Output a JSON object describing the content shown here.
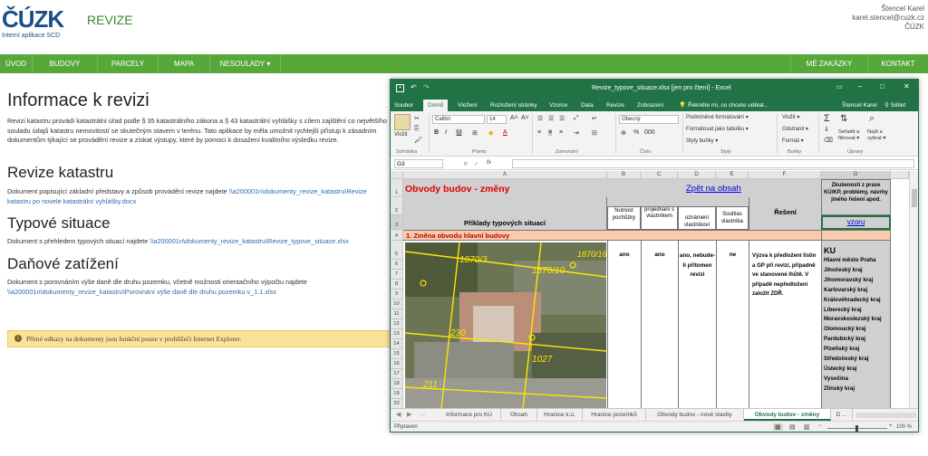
{
  "header": {
    "logo": "ČÚZK",
    "logo_sub": "Interní aplikace SCD",
    "app_title": "REVIZE",
    "user_name": "Štencel Karel",
    "user_email": "karel.stencel@cuzk.cz",
    "user_org": "ČÚZK"
  },
  "nav": {
    "items": [
      "ÚVOD",
      "BUDOVY",
      "PARCELY",
      "MAPA",
      "NESOULADY ▾"
    ],
    "right_items": [
      "MÉ ZAKÁZKY",
      "KONTAKT"
    ]
  },
  "content": {
    "title": "Informace k revizi",
    "intro": "Revizi katastru provádí katastrální úřad podle § 35 katastrálního zákona a § 43 katastrální vyhlášky s cílem zajištění co největšího souladu údajů katastru nemovitostí se skutečným stavem v terénu. Tato aplikace by měla umožnit rychlejší přístup k zásadním dokumentům týkající se provádění revize a získat výstupy, které by pomoci k dosažení kvalitního výsledku revize.",
    "s1_title": "Revize katastru",
    "s1_text": "Dokument popisující základní představy a způsob provádění revize najdete ",
    "s1_link": "\\\\a200001n\\dokumenty_revize_katastru\\Revize katastru po novele katastrální vyhlášky.docx",
    "s2_title": "Typové situace",
    "s2_text": "Dokument s přehledem typových situací najdete ",
    "s2_link": "\\\\a200001n\\dokumenty_revize_katastru\\Revize_typove_situace.xlsx",
    "s3_title": "Daňové zatížení",
    "s3_text": "Dokument s porovnáním výše daně dle druhu pozemku, včetně možnosti orientačního výpočtu najdete ",
    "s3_link": "\\\\a200001n\\dokumenty_revize_katastru\\Porovnání výše daně dle druhu pozemku v_1.1.xlsx",
    "notice": "Přímé odkazy na dokumenty jsou funkční pouze v prohlížeči Internet Explorer."
  },
  "excel": {
    "title": "Revize_typove_situace.xlsx  [jen pro čtení]  -  Excel",
    "user": "Štencel Karel",
    "share": "Sdílet",
    "ribbon_tabs": [
      "Soubor",
      "Domů",
      "Vložení",
      "Rozložení stránky",
      "Vzorce",
      "Data",
      "Revize",
      "Zobrazení"
    ],
    "tell_me": "Řekněte mi, co chcete udělat...",
    "font_name": "Calibri",
    "font_size": "14",
    "number_format": "Obecný",
    "groups": [
      "Schránka",
      "Písmo",
      "Zarovnání",
      "Číslo",
      "Styly",
      "Buňky",
      "Úpravy"
    ],
    "styles_items": [
      "Podmíněné formátování ▾",
      "Formátovat jako tabulku ▾",
      "Styly buňky ▾"
    ],
    "cells_items": [
      "Vložit ▾",
      "Odstranit ▾",
      "Formát ▾"
    ],
    "edit_items": [
      "Seřadit a filtrovat ▾",
      "Najít a vybrat ▾"
    ],
    "paste_label": "Vložit",
    "name_box": "G3",
    "fx": "fx",
    "columns": [
      "A",
      "B",
      "C",
      "D",
      "E",
      "F",
      "G"
    ],
    "rows": [
      "1",
      "2",
      "3",
      "4",
      "5",
      "6",
      "7",
      "8",
      "9",
      "10",
      "11",
      "12",
      "13",
      "14",
      "15",
      "16",
      "17",
      "18",
      "19",
      "20"
    ],
    "sheet_title": "Obvody budov - změny",
    "back_link": "Zpět na obsah",
    "col_headers": {
      "a": "Příklady typových situací",
      "b": "Nutnost pochůzky",
      "c": "projednání s vlastníkem",
      "d": "oznámení vlastníkovi",
      "e": "Souhlas vlastníka",
      "f": "Řešení",
      "g": "Zkušenosti z praxe KÚ/KP, problémy, návrhy jiného řešení apod."
    },
    "vzoru": "vzoru",
    "section_title": "1. Změna obvodu hlavní budovy",
    "row_values": {
      "b": "ano",
      "c": "ano",
      "d": "ano, nebude-li přítomen revizi",
      "e": "ne"
    },
    "solution": "Výzva k předložení listin a GP při revizi, případně ve stanovené lhůtě. V případě nepředložení založit ZDŘ.",
    "ku_title": "KU",
    "ku_list": [
      "Hlavní město Praha",
      "Jihočeský kraj",
      "Jihomoravský kraj",
      "Karlovarský kraj",
      "Královéhradecký kraj",
      "Liberecký kraj",
      "Moravskoslezský kraj",
      "Olomoucký kraj",
      "Pardubický kraj",
      "Plzeňský kraj",
      "Středočeský kraj",
      "Ústecký kraj",
      "Vysočina",
      "Zlínský kraj"
    ],
    "map_labels": [
      "1870/3",
      "1870/10",
      "1870/16",
      "230",
      "1027",
      "211"
    ],
    "sheet_tabs": [
      "Informace pro KÚ",
      "Obsah",
      "Hranice k.ú.",
      "Hranice pozemků",
      "Obvody budov - nové stavby",
      "Obvody budov - změny",
      "D ..."
    ],
    "status": "Připraven",
    "zoom": "100 %"
  }
}
